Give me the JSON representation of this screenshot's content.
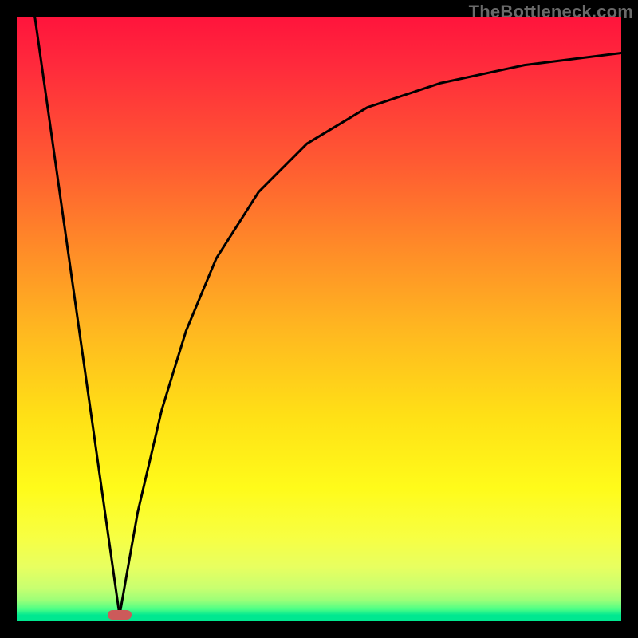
{
  "watermark": "TheBottleneck.com",
  "colors": {
    "frame": "#000000",
    "curve": "#000000",
    "marker": "#cc5a5a",
    "gradient_top": "#ff143c",
    "gradient_bottom": "#00e890"
  },
  "chart_data": {
    "type": "line",
    "title": "",
    "xlabel": "",
    "ylabel": "",
    "xlim": [
      0,
      100
    ],
    "ylim": [
      0,
      100
    ],
    "note": "No axis ticks or numeric labels are rendered in the figure; values are estimated from pixel geometry on a 0–100 normalized domain/range.",
    "series": [
      {
        "name": "left-branch",
        "description": "Steep descending straight segment from top-left down to the trough",
        "x": [
          3,
          17
        ],
        "y": [
          100,
          1
        ]
      },
      {
        "name": "right-branch",
        "description": "Ascending concave curve from the trough rising and flattening toward the right edge",
        "x": [
          17,
          20,
          24,
          28,
          33,
          40,
          48,
          58,
          70,
          84,
          100
        ],
        "y": [
          1,
          18,
          35,
          48,
          60,
          71,
          79,
          85,
          89,
          92,
          94
        ]
      }
    ],
    "trough": {
      "x_range": [
        15,
        19
      ],
      "y": 1
    },
    "marker": {
      "shape": "rounded-rect",
      "x_center": 17,
      "y_center": 1,
      "width": 4,
      "height": 1.6,
      "color_ref": "marker"
    },
    "background": {
      "type": "vertical-gradient",
      "stops": [
        {
          "pos": 0.0,
          "color": "#ff143c"
        },
        {
          "pos": 0.38,
          "color": "#ff8a28"
        },
        {
          "pos": 0.66,
          "color": "#ffe016"
        },
        {
          "pos": 0.86,
          "color": "#f7ff42"
        },
        {
          "pos": 0.95,
          "color": "#c8ff70"
        },
        {
          "pos": 1.0,
          "color": "#00e890"
        }
      ]
    }
  }
}
